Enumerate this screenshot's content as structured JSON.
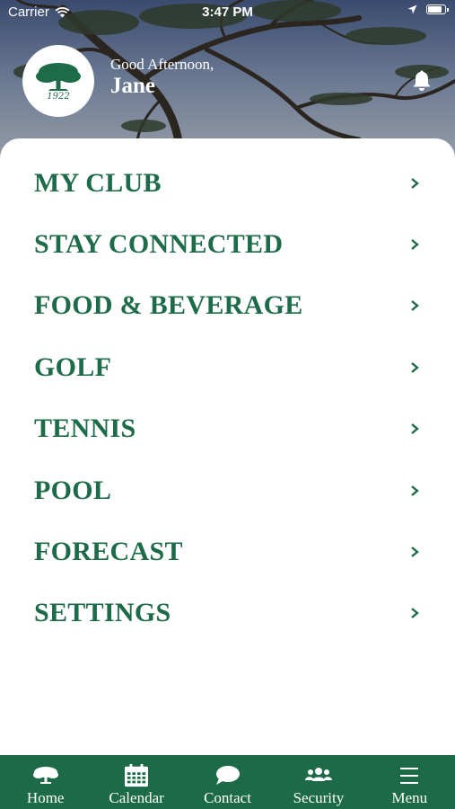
{
  "status_bar": {
    "carrier": "Carrier",
    "time": "3:47 PM"
  },
  "header": {
    "logo_year": "1922",
    "greeting": "Good Afternoon,",
    "user_name": "Jane"
  },
  "menu": {
    "items": [
      {
        "label": "MY CLUB"
      },
      {
        "label": "STAY CONNECTED"
      },
      {
        "label": "FOOD & BEVERAGE"
      },
      {
        "label": "GOLF"
      },
      {
        "label": "TENNIS"
      },
      {
        "label": "POOL"
      },
      {
        "label": "FORECAST"
      },
      {
        "label": "SETTINGS"
      }
    ],
    "chevron": "chevron-right-icon"
  },
  "tab_bar": {
    "tabs": [
      {
        "label": "Home",
        "icon": "tree-icon"
      },
      {
        "label": "Calendar",
        "icon": "calendar-icon"
      },
      {
        "label": "Contact",
        "icon": "speech-bubble-icon"
      },
      {
        "label": "Security",
        "icon": "people-icon"
      },
      {
        "label": "Menu",
        "icon": "hamburger-menu-icon"
      }
    ]
  },
  "colors": {
    "brand_green": "#1d6b48",
    "tab_bar_green": "#1c6a48",
    "text_white": "#ffffff"
  }
}
